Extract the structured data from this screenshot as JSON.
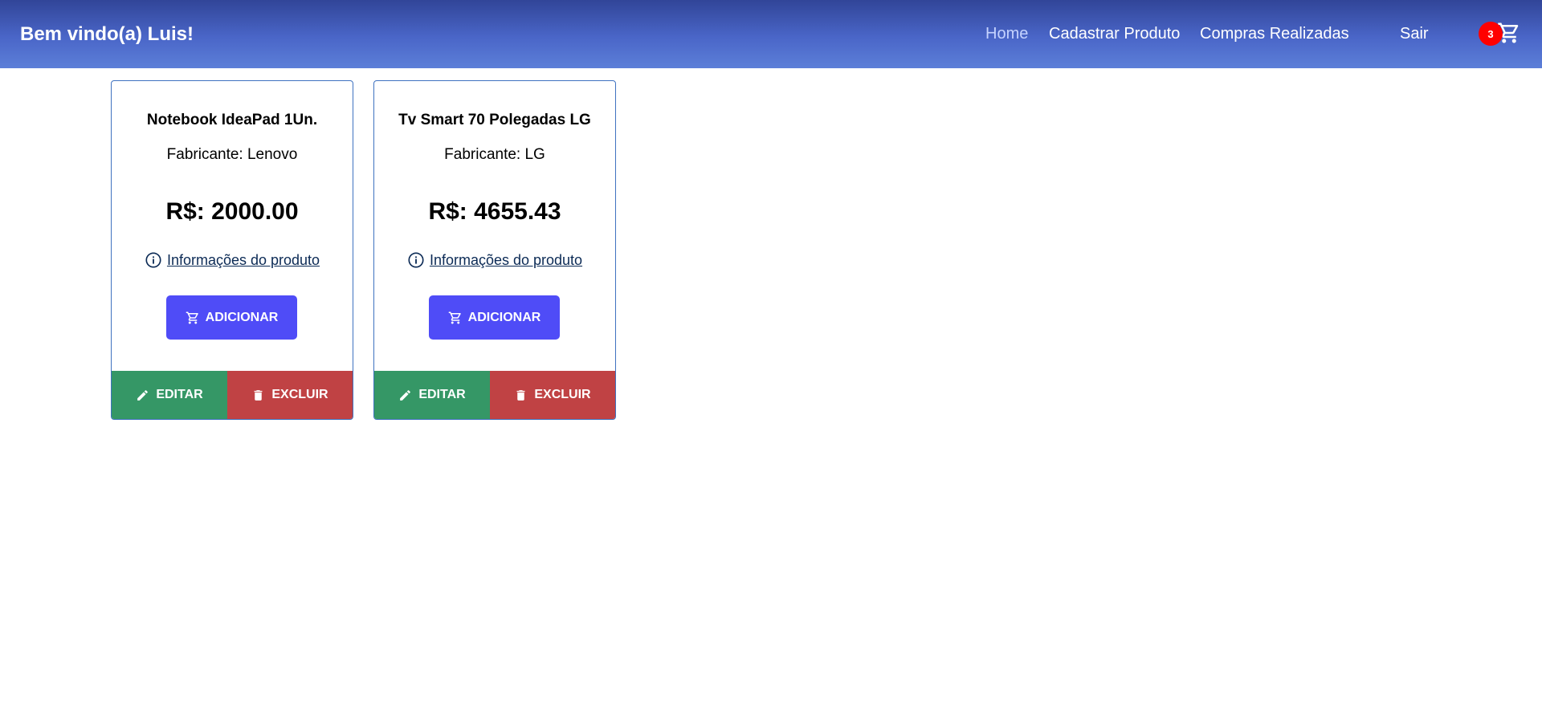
{
  "header": {
    "welcome": "Bem vindo(a) Luis!",
    "nav": {
      "home": "Home",
      "register_product": "Cadastrar Produto",
      "purchases": "Compras Realizadas",
      "logout": "Sair"
    },
    "cart": {
      "count": "3",
      "icon": "cart-icon",
      "badge_color": "#ff0000"
    }
  },
  "products": [
    {
      "name": "Notebook IdeaPad 1Un.",
      "manufacturer": "Fabricante: Lenovo",
      "price": "R$: 2000.00",
      "info_link": "Informações do produto",
      "add_label": "ADICIONAR",
      "edit_label": "EDITAR",
      "delete_label": "EXCLUIR"
    },
    {
      "name": "Tv Smart 70 Polegadas LG",
      "manufacturer": "Fabricante: LG",
      "price": "R$: 4655.43",
      "info_link": "Informações do produto",
      "add_label": "ADICIONAR",
      "edit_label": "EDITAR",
      "delete_label": "EXCLUIR"
    }
  ],
  "colors": {
    "header_gradient_top": "#314598",
    "header_gradient_bottom": "#5c7fd8",
    "add_button": "#4f4cf7",
    "edit_button": "#359766",
    "delete_button": "#c04244",
    "card_border": "#3f72c0"
  }
}
